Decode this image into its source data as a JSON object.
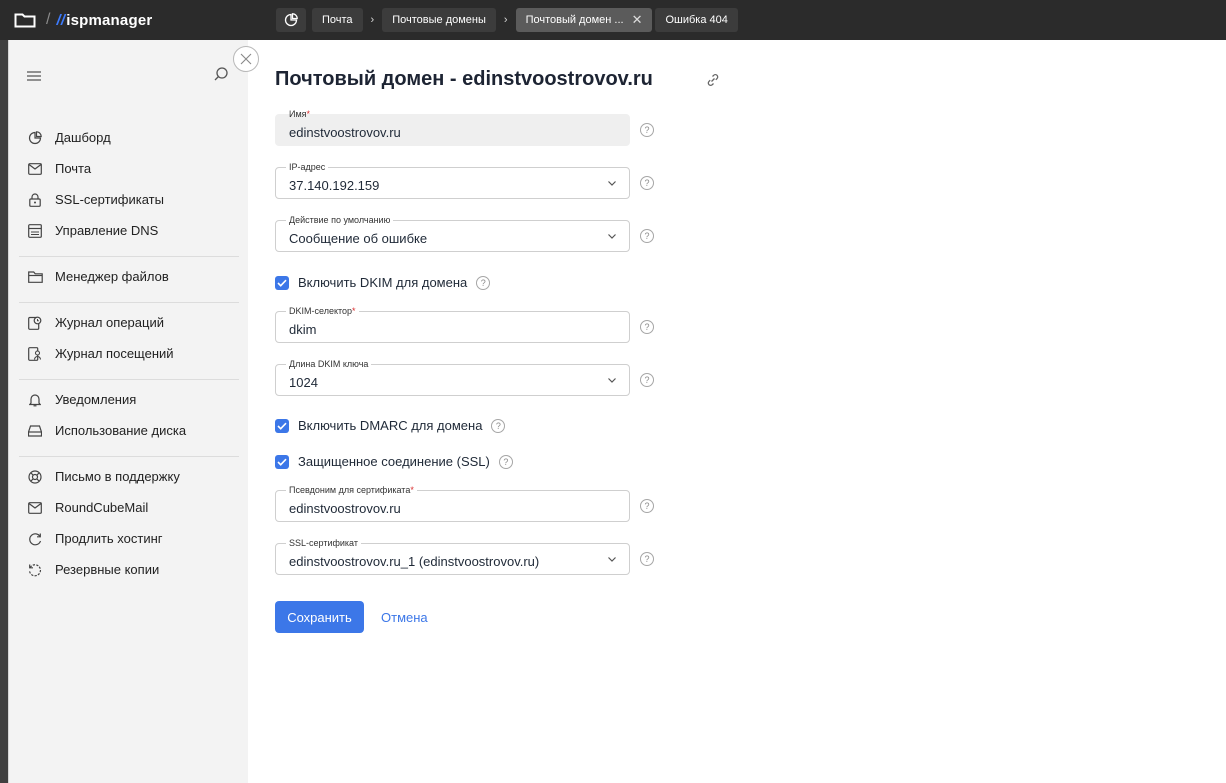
{
  "brand": {
    "name": "ispmanager"
  },
  "breadcrumbs": [
    {
      "label": "Почта"
    },
    {
      "label": "Почтовые домены"
    },
    {
      "label": "Почтовый домен ..."
    },
    {
      "label": "Ошибка 404"
    }
  ],
  "sidebar": {
    "groups": [
      [
        {
          "label": "Дашборд",
          "icon": "dashboard-icon"
        },
        {
          "label": "Почта",
          "icon": "mail-icon"
        },
        {
          "label": "SSL-сертификаты",
          "icon": "lock-icon"
        },
        {
          "label": "Управление DNS",
          "icon": "dns-icon"
        }
      ],
      [
        {
          "label": "Менеджер файлов",
          "icon": "folder-icon"
        }
      ],
      [
        {
          "label": "Журнал операций",
          "icon": "operations-log-icon"
        },
        {
          "label": "Журнал посещений",
          "icon": "visits-log-icon"
        }
      ],
      [
        {
          "label": "Уведомления",
          "icon": "bell-icon"
        },
        {
          "label": "Использование диска",
          "icon": "disk-icon"
        }
      ],
      [
        {
          "label": "Письмо в поддержку",
          "icon": "support-icon"
        },
        {
          "label": "RoundCubeMail",
          "icon": "mail-icon"
        },
        {
          "label": "Продлить хостинг",
          "icon": "renew-icon"
        },
        {
          "label": "Резервные копии",
          "icon": "backup-icon"
        }
      ]
    ]
  },
  "page": {
    "title": "Почтовый домен - edinstvoostrovov.ru"
  },
  "form": {
    "name": {
      "label": "Имя",
      "required": "*",
      "value": "edinstvoostrovov.ru"
    },
    "ip": {
      "label": "IP-адрес",
      "value": "37.140.192.159"
    },
    "default_action": {
      "label": "Действие по умолчанию",
      "value": "Сообщение об ошибке"
    },
    "dkim_enable": {
      "label": "Включить DKIM для домена",
      "checked": true
    },
    "dkim_selector": {
      "label": "DKIM-селектор",
      "required": "*",
      "value": "dkim"
    },
    "dkim_length": {
      "label": "Длина DKIM ключа",
      "value": "1024"
    },
    "dmarc_enable": {
      "label": "Включить DMARC для домена",
      "checked": true
    },
    "ssl_enable": {
      "label": "Защищенное соединение (SSL)",
      "checked": true
    },
    "cert_alias": {
      "label": "Псевдоним для сертификата",
      "required": "*",
      "value": "edinstvoostrovov.ru"
    },
    "ssl_cert": {
      "label": "SSL-сертификат",
      "value": "edinstvoostrovov.ru_1 (edinstvoostrovov.ru)"
    },
    "help_glyph": "?",
    "save_label": "Сохранить",
    "cancel_label": "Отмена"
  },
  "colors": {
    "accent": "#3c77e8",
    "topbar": "#2b2b2b",
    "sidebar": "#f3f3f3",
    "required": "#d92d2d"
  }
}
